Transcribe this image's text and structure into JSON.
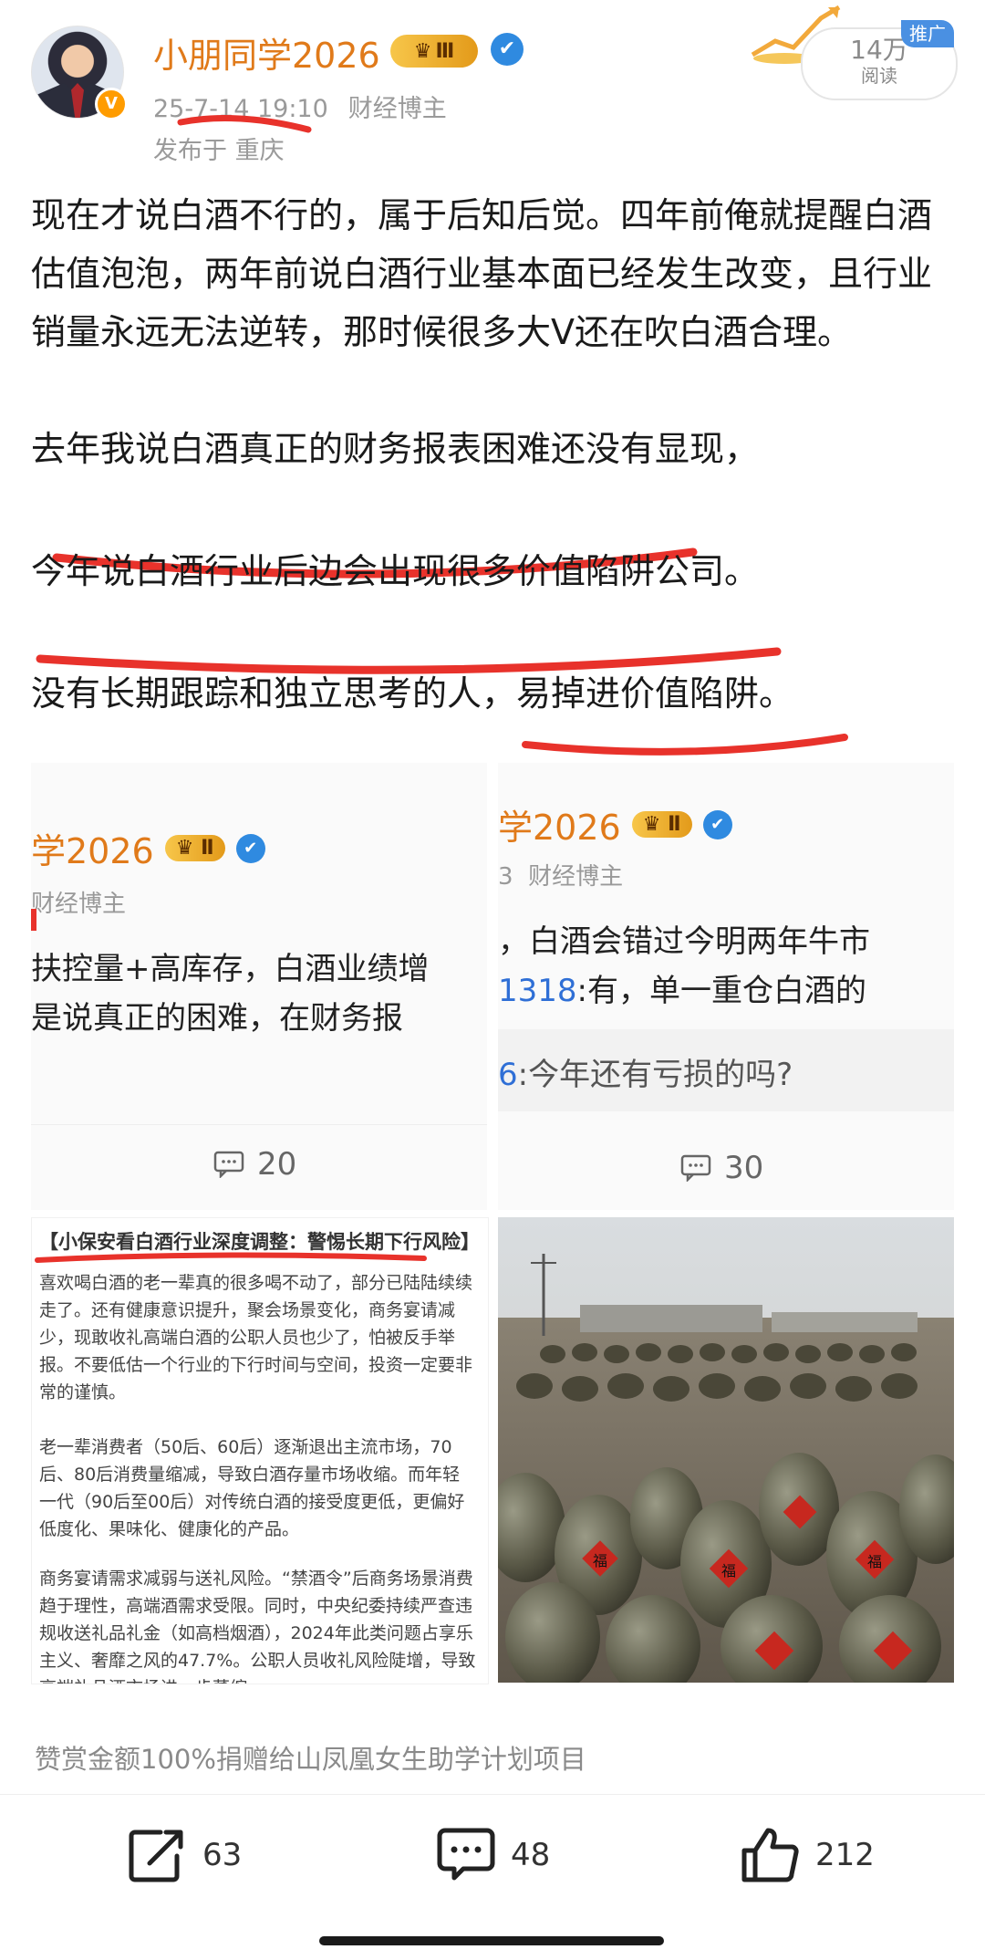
{
  "header": {
    "username": "小朋同学2026",
    "level_badge": "Ⅲ",
    "views_count": "14万",
    "views_label": "阅读",
    "ad_tag": "推广",
    "post_time": "25-7-14 19:10",
    "category": "财经博主",
    "location": "发布于 重庆",
    "verified_badge": "V"
  },
  "post": {
    "paragraph1": "现在才说白酒不行的，属于后知后觉。四年前俺就提醒白酒估值泡泡，两年前说白酒行业基本面已经发生改变，且行业销量永远无法逆转，那时候很多大V还在吹白酒合理。",
    "paragraph2": "去年我说白酒真正的财务报表困难还没有显现，",
    "paragraph3": "今年说白酒行业后边会出现很多价值陷阱公司。",
    "paragraph4": "没有长期跟踪和独立思考的人，易掉进价值陷阱。"
  },
  "images": {
    "tile1": {
      "name": "学2026",
      "badge": "Ⅱ",
      "category": "财经博主",
      "line1": "扶控量+高库存，白酒业绩增",
      "line2": "是说真正的困难，在财务报",
      "comments": "20"
    },
    "tile2": {
      "name": "学2026",
      "badge": "Ⅱ",
      "category_prefix": "3",
      "category": "财经博主",
      "line1": "，白酒会错过今明两年牛市",
      "line2_user": "1318",
      "line2": ":有，单一重仓白酒的",
      "line3_user": "6",
      "line3": ":今年还有亏损的吗?",
      "comments": "30"
    },
    "tile3": {
      "title": "【小保安看白酒行业深度调整：警惕长期下行风险】",
      "p1": "喜欢喝白酒的老一辈真的很多喝不动了，部分已陆陆续续走了。还有健康意识提升，聚会场景变化，商务宴请减少，现敢收礼高端白酒的公职人员也少了，怕被反手举报。不要低估一个行业的下行时间与空间，投资一定要非常的谨慎。",
      "p2": "老一辈消费者（50后、60后）逐渐退出主流市场，70后、80后消费量缩减，导致白酒存量市场收缩。而年轻一代（90后至00后）对传统白酒的接受度更低，更偏好低度化、果味化、健康化的产品。",
      "p3": "商务宴请需求减弱与送礼风险。“禁酒令”后商务场景消费趋于理性，高端酒需求受限。同时，中央纪委持续严查违规收送礼品礼金（如高档烟酒），2024年此类问题占享乐主义、奢靡之风的47.7%。公职人员收礼风险陡增，导致高端礼品酒市场进一步萎缩。"
    },
    "tile4": {
      "jar_label": "福"
    }
  },
  "donate_text": "赞赏金额100%捐赠给山凤凰女生助学计划项目",
  "actions": {
    "share_count": "63",
    "comment_count": "48",
    "like_count": "212"
  },
  "colors": {
    "accent": "#e07a1a",
    "underline": "#e8322b",
    "verify": "#2f8ae0"
  }
}
